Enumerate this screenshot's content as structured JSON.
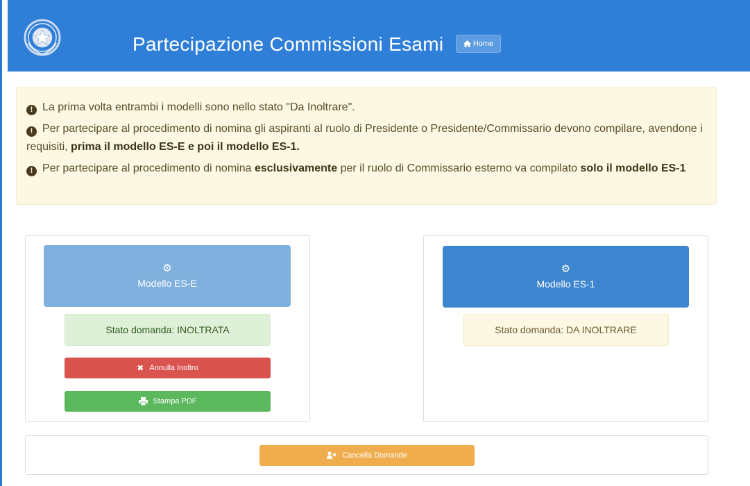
{
  "header": {
    "title": "Partecipazione Commissioni Esami",
    "home_label": "Home",
    "color": "#2f7fd8"
  },
  "notice": {
    "items": [
      {
        "text": "La prima volta entrambi i modelli sono nello stato \"Da Inoltrare\"."
      },
      {
        "text_a": "Per partecipare al procedimento di nomina gli aspiranti al ruolo di Presidente o Presidente/Commissario devono compilare, avendone i requisiti, ",
        "bold_a": "prima il modello ES-E e poi il modello ES-1."
      },
      {
        "text_a": "Per partecipare al procedimento di nomina ",
        "bold_a": "esclusivamente",
        "text_b": " per il ruolo di Commissario esterno va compilato ",
        "bold_b": "solo il modello ES-1"
      }
    ]
  },
  "models": [
    {
      "label": "Modello ES-E",
      "status": "Stato domanda: INOLTRATA",
      "actions": [
        {
          "label": "Annulla Inoltro",
          "icon": "x-icon",
          "color": "#d9534f"
        },
        {
          "label": "Stampa PDF",
          "icon": "print-icon",
          "color": "#5cb85c"
        }
      ]
    },
    {
      "label": "Modello ES-1",
      "status": "Stato domanda: DA INOLTRARE"
    }
  ],
  "footer": {
    "cancel_label": "Cancella Domande",
    "color": "#f0ad4e"
  }
}
